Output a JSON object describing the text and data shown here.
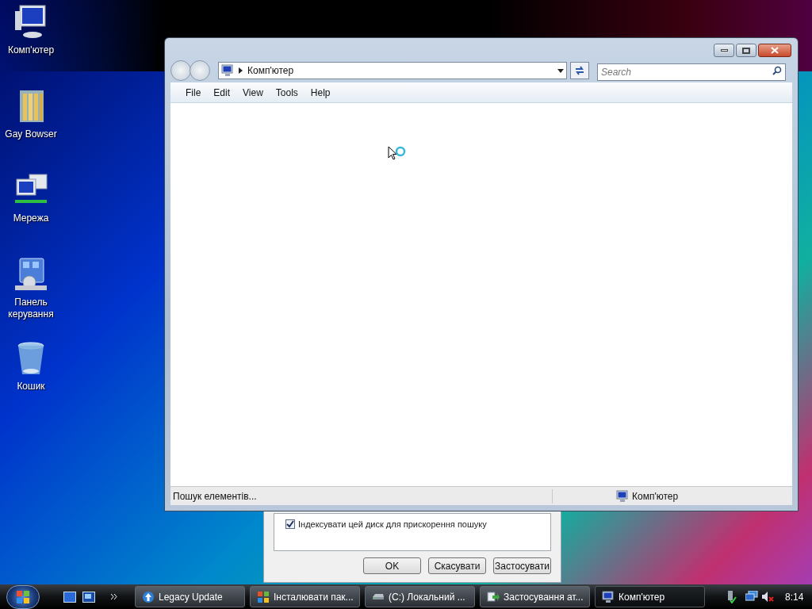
{
  "desktop_icons": [
    {
      "label": "Комп'ютер",
      "kind": "computer"
    },
    {
      "label": "Gay Bowser",
      "kind": "folder"
    },
    {
      "label": "Мережа",
      "kind": "network"
    },
    {
      "label": "Панель керування",
      "kind": "control"
    },
    {
      "label": "Кошик",
      "kind": "bin"
    }
  ],
  "dialog": {
    "checkbox": {
      "label": "Індексувати цей диск для прискорення пошуку",
      "checked": true
    },
    "buttons": [
      "OK",
      "Скасувати",
      "Застосувати"
    ]
  },
  "window": {
    "address": "Комп'ютер",
    "search": {
      "placeholder": "Search"
    },
    "menu": [
      "File",
      "Edit",
      "View",
      "Tools",
      "Help"
    ],
    "status": {
      "text": "Пошук елементів...",
      "location": "Комп'ютер"
    }
  },
  "taskbar": {
    "buttons": [
      {
        "label": "Legacy Update",
        "kind": "update",
        "selected": false
      },
      {
        "label": "Інсталювати пак...",
        "kind": "install",
        "selected": false
      },
      {
        "label": "(C:) Локальний ...",
        "kind": "drive",
        "selected": false
      },
      {
        "label": "Застосування ат...",
        "kind": "apply",
        "selected": false
      },
      {
        "label": "Комп'ютер",
        "kind": "computer",
        "selected": true
      }
    ],
    "clock": "8:14"
  }
}
